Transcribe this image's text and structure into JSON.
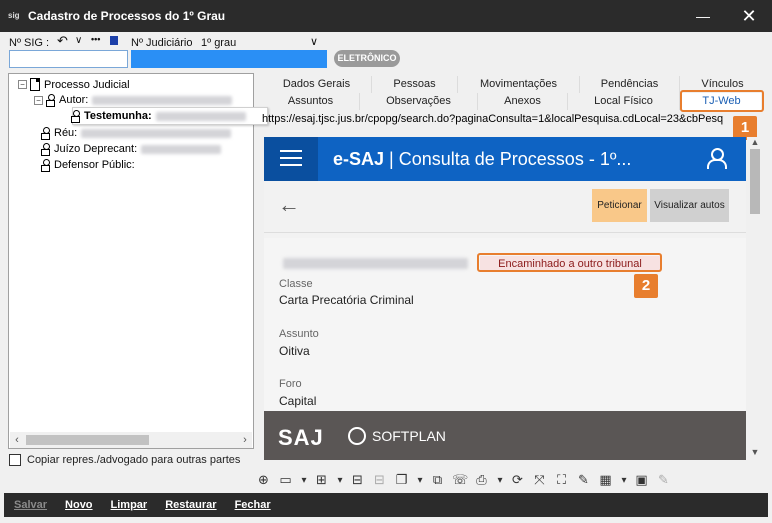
{
  "window": {
    "title": "Cadastro de Processos do 1º Grau",
    "minimize": "—",
    "close": "✕"
  },
  "top": {
    "sig_label": "Nº SIG :",
    "nav_back": "↶",
    "nav_down": "∨",
    "nav_more": "•••",
    "judiciario_label": "Nº Judiciário",
    "grau_label": "1º grau",
    "grau_chevron": "∨",
    "eletronico_badge": "ELETRÔNICO"
  },
  "tree": {
    "expand_minus": "−",
    "root": "Processo Judicial",
    "nodes": [
      {
        "label": "Autor:"
      },
      {
        "label": "Testemunha:"
      },
      {
        "label": "Réu:"
      },
      {
        "label": "Juízo Deprecant:"
      },
      {
        "label": "Defensor Públic:"
      }
    ],
    "scroll_left": "‹",
    "scroll_right": "›"
  },
  "checkbox_label": "Copiar repres./advogado para outras partes",
  "tabs_row1": [
    "Dados Gerais",
    "Pessoas",
    "Movimentações",
    "Pendências",
    "Vínculos"
  ],
  "tabs_row2": [
    "Assuntos",
    "Observações",
    "Anexos",
    "Local Físico",
    "TJ-Web"
  ],
  "badges": [
    "1",
    "2"
  ],
  "browser": {
    "url": "https://esaj.tjsc.jus.br/cpopg/search.do?paginaConsulta=1&localPesquisa.cdLocal=23&cbPesq",
    "brand": "e-SAJ",
    "heading": "| Consulta de Processos - 1º...",
    "back": "←",
    "peticionar": "Peticionar",
    "visualizar": "Visualizar autos",
    "status": "Encaminhado a outro tribunal",
    "fields": [
      {
        "label": "Classe",
        "value": "Carta Precatória Criminal"
      },
      {
        "label": "Assunto",
        "value": "Oitiva"
      },
      {
        "label": "Foro",
        "value": "Capital"
      }
    ],
    "footer_logo": "SAJ",
    "footer_brand": "SOFTPLAN",
    "scroll_up": "▲",
    "scroll_down": "▼"
  },
  "toolbar_icons": [
    {
      "name": "add-party-icon",
      "glyph": "⊕"
    },
    {
      "name": "folder-icon",
      "glyph": "▭"
    },
    {
      "name": "dropdown-icon",
      "glyph": "▾"
    },
    {
      "name": "hierarchy-icon",
      "glyph": "⊞"
    },
    {
      "name": "dropdown-icon",
      "glyph": "▾"
    },
    {
      "name": "network-icon",
      "glyph": "⊟"
    },
    {
      "name": "network-disabled-icon",
      "glyph": "⊟"
    },
    {
      "name": "documents-icon",
      "glyph": "❐"
    },
    {
      "name": "dropdown-icon",
      "glyph": "▾"
    },
    {
      "name": "copy-icon",
      "glyph": "⧉"
    },
    {
      "name": "phone-icon",
      "glyph": "☏"
    },
    {
      "name": "print-icon",
      "glyph": "⎙"
    },
    {
      "name": "dropdown-icon",
      "glyph": "▾"
    },
    {
      "name": "refresh-icon",
      "glyph": "⟳"
    },
    {
      "name": "expand-icon",
      "glyph": "⤧"
    },
    {
      "name": "fullscreen-icon",
      "glyph": "⛶"
    },
    {
      "name": "edit-doc-icon",
      "glyph": "✎"
    },
    {
      "name": "calendar-icon",
      "glyph": "▦"
    },
    {
      "name": "dropdown-icon",
      "glyph": "▾"
    },
    {
      "name": "photo-icon",
      "glyph": "▣"
    },
    {
      "name": "edit-disabled-icon",
      "glyph": "✎"
    }
  ],
  "actions": {
    "salvar": "Salvar",
    "novo": "Novo",
    "limpar": "Limpar",
    "restaurar": "Restaurar",
    "fechar": "Fechar"
  },
  "colors": {
    "accent_orange": "#e87e2e",
    "esaj_blue": "#0e63c3",
    "field_blue": "#2a8ff5"
  }
}
